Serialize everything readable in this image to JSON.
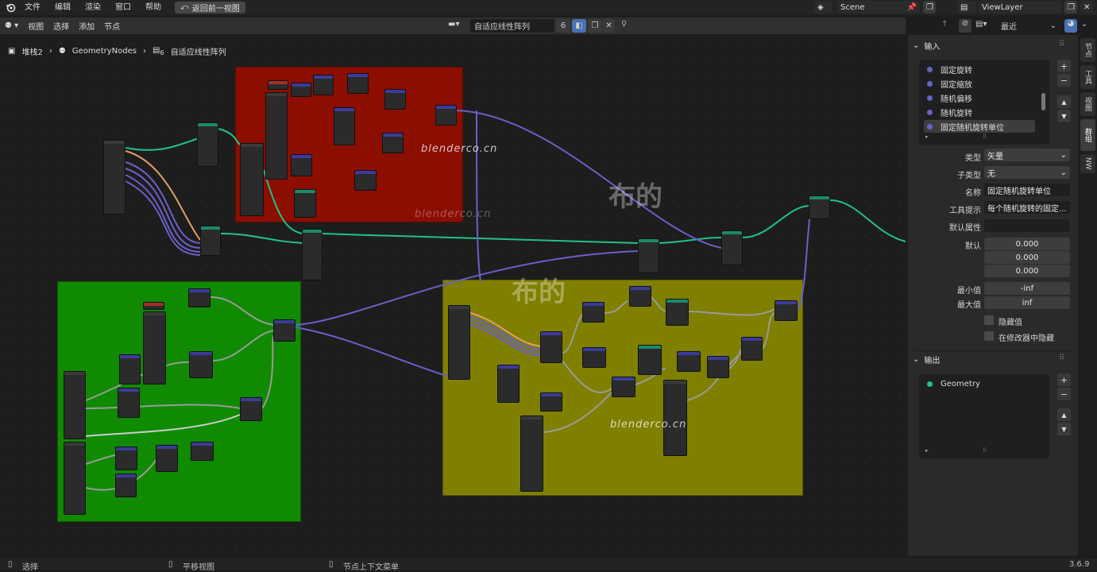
{
  "menubar": {
    "items": [
      "文件",
      "编辑",
      "渲染",
      "窗口",
      "帮助"
    ],
    "back_button": "返回前一视图",
    "scene": "Scene",
    "view_layer": "ViewLayer"
  },
  "editor_header": {
    "menus": [
      "视图",
      "选择",
      "添加",
      "节点"
    ],
    "node_tree_name": "自适应线性阵列",
    "users_count": "6",
    "recent_label": "最近"
  },
  "breadcrumb": {
    "items": [
      "堆栈2",
      "GeometryNodes",
      "自适应线性阵列"
    ],
    "sub_index": "6"
  },
  "watermarks": {
    "site": "blenderco.cn",
    "brand": "布的"
  },
  "sidebar": {
    "inputs_title": "输入",
    "input_items": [
      "固定旋转",
      "固定缩放",
      "随机偏移",
      "随机旋转",
      "固定随机旋转单位"
    ],
    "selected_index": 4,
    "properties": {
      "type_label": "类型",
      "type_value": "矢量",
      "subtype_label": "子类型",
      "subtype_value": "无",
      "name_label": "名称",
      "name_value": "固定随机旋转单位",
      "tooltip_label": "工具提示",
      "tooltip_value": "每个随机旋转的固定...",
      "default_attr_label": "默认属性",
      "default_attr_value": "",
      "default_label": "默认",
      "default_values": [
        "0.000",
        "0.000",
        "0.000"
      ],
      "min_label": "最小值",
      "min_value": "-inf",
      "max_label": "最大值",
      "max_value": "inf",
      "hide_value_label": "隐藏值",
      "hide_in_modifier_label": "在修改器中隐藏"
    },
    "outputs_title": "输出",
    "output_items": [
      "Geometry"
    ]
  },
  "vertical_tabs": [
    "节点",
    "工具",
    "视图",
    "群组",
    "NW"
  ],
  "status_bar": {
    "select": "选择",
    "pan": "平移视图",
    "context_menu": "节点上下文菜单",
    "version": "3.6.9"
  },
  "colors": {
    "frame_red": "#8b0e00",
    "frame_green": "#108a00",
    "frame_yellow": "#7f7f00",
    "link_geometry": "#1fc28e",
    "link_vector": "#6a5fc8",
    "link_float": "#a0a0a0",
    "link_orange": "#e0a060",
    "input_dot": "#6464c8",
    "output_dot": "#1fc28e",
    "accent": "#4772b3"
  }
}
